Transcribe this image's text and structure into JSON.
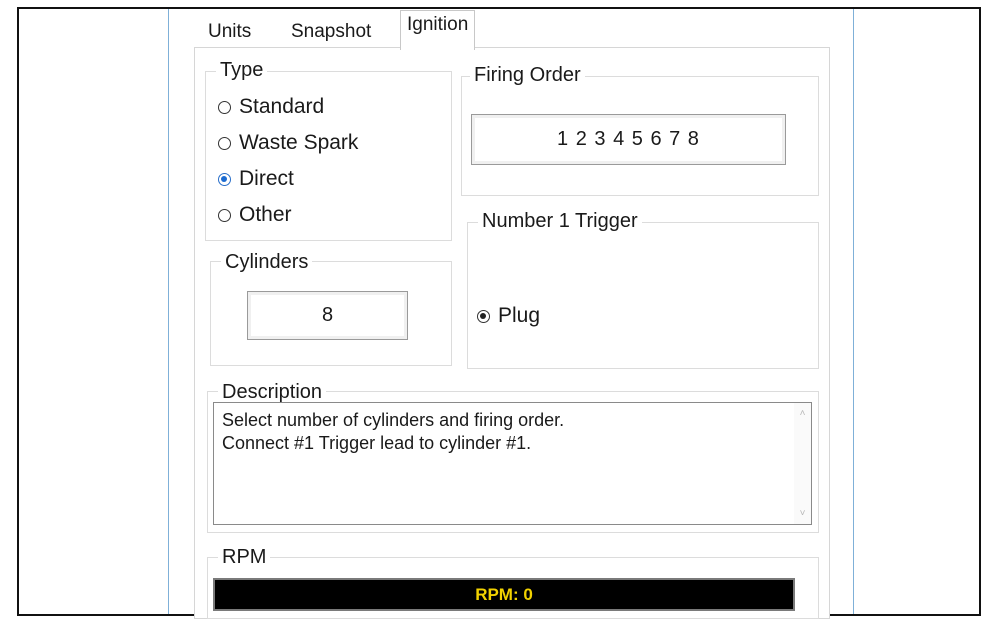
{
  "tabs": [
    {
      "label": "Units"
    },
    {
      "label": "Snapshot"
    },
    {
      "label": "Ignition"
    }
  ],
  "active_tab": "Ignition",
  "type_group": {
    "label": "Type",
    "options": [
      {
        "label": "Standard",
        "checked": false
      },
      {
        "label": "Waste Spark",
        "checked": false
      },
      {
        "label": "Direct",
        "checked": true
      },
      {
        "label": "Other",
        "checked": false
      }
    ]
  },
  "firing_order": {
    "label": "Firing Order",
    "value": "1 2 3 4 5 6 7 8"
  },
  "trigger": {
    "label": "Number 1 Trigger",
    "option_label": "Plug",
    "checked": true
  },
  "cylinders": {
    "label": "Cylinders",
    "value": "8"
  },
  "description": {
    "label": "Description",
    "line1": "Select number of cylinders and firing order.",
    "line2": "Connect #1 Trigger lead to cylinder #1."
  },
  "rpm": {
    "label": "RPM",
    "readout": "RPM: 0"
  },
  "colors": {
    "rpm_bg": "#000000",
    "rpm_text": "#f2d200",
    "radio_selected": "#1b6bd1"
  }
}
